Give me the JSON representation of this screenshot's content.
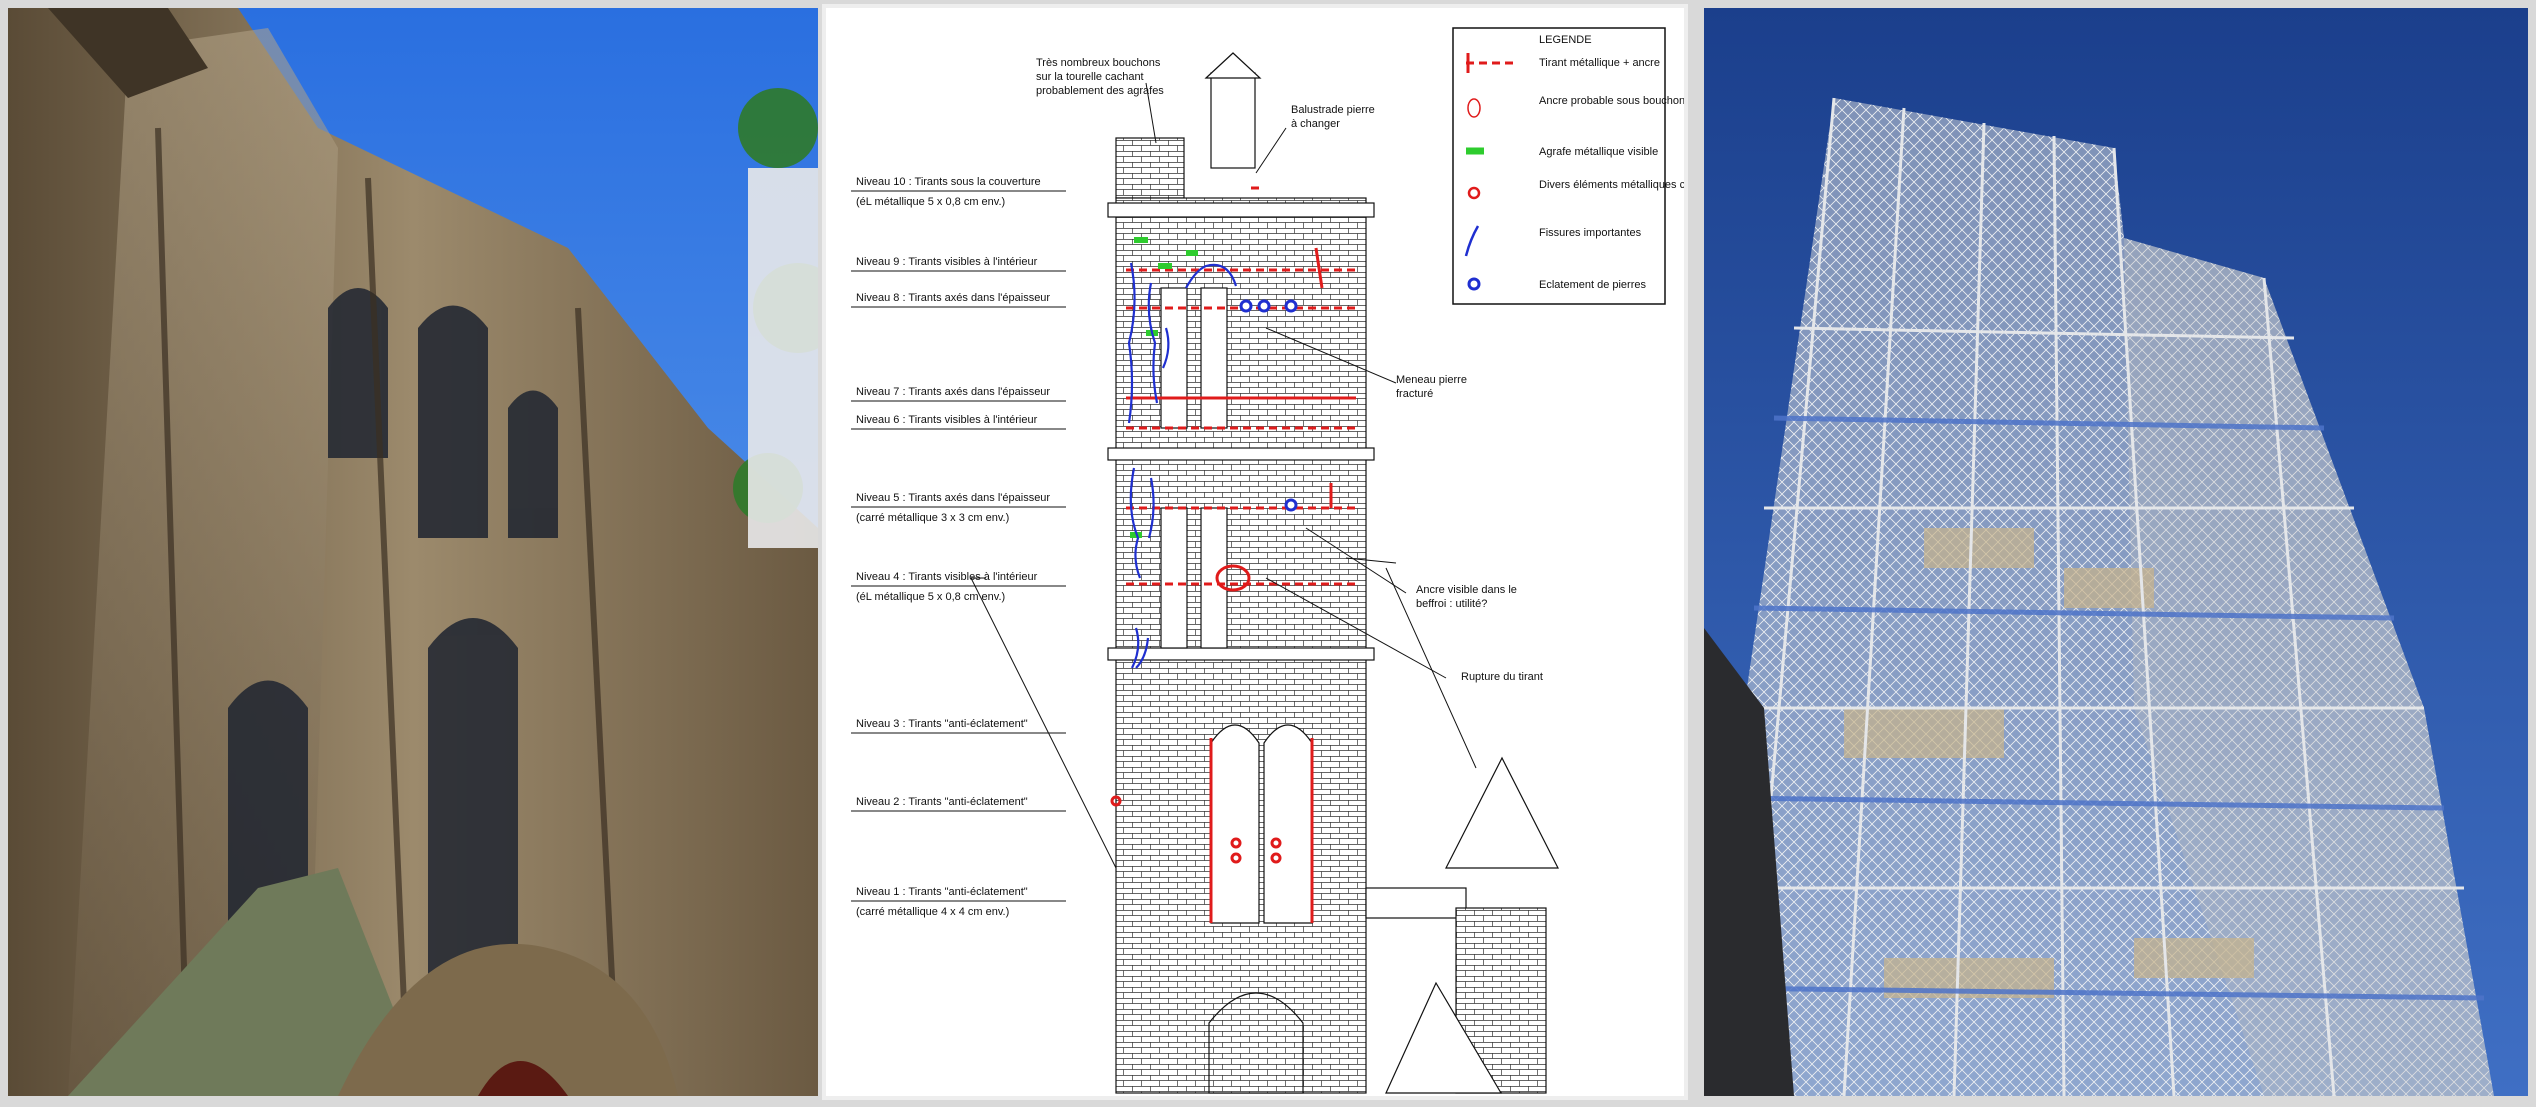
{
  "photos": {
    "left": {
      "name": "church-facade-photo"
    },
    "right": {
      "name": "tower-scaffolding-photo"
    }
  },
  "legend": {
    "title": "LEGENDE",
    "items": [
      {
        "label": "Tirant métallique + ancre",
        "symbol": "red-dashed-anchor-icon",
        "color": "#e01b1b"
      },
      {
        "label": "Ancre probable sous bouchon d'enduit",
        "symbol": "red-ellipse-icon",
        "color": "#e01b1b"
      },
      {
        "label": "Agrafe métallique visible",
        "symbol": "green-bar-icon",
        "color": "#2ecc2e"
      },
      {
        "label": "Divers éléments métalliques corrodés",
        "symbol": "red-circle-icon",
        "color": "#e01b1b"
      },
      {
        "label": "Fissures importantes",
        "symbol": "blue-crack-icon",
        "color": "#1f2fd0"
      },
      {
        "label": "Eclatement de pierres",
        "symbol": "blue-dot-icon",
        "color": "#1f2fd0"
      }
    ]
  },
  "levels": [
    {
      "title": "Niveau 10 : Tirants sous la couverture",
      "detail": "(éL métallique 5 x 0,8 cm env.)"
    },
    {
      "title": "Niveau 9 : Tirants visibles à l'intérieur",
      "detail": ""
    },
    {
      "title": "Niveau 8 : Tirants axés dans l'épaisseur",
      "detail": ""
    },
    {
      "title": "Niveau 7 : Tirants axés dans l'épaisseur",
      "detail": ""
    },
    {
      "title": "Niveau 6 : Tirants visibles à l'intérieur",
      "detail": ""
    },
    {
      "title": "Niveau 5 : Tirants axés dans l'épaisseur",
      "detail": "(carré métallique 3 x 3 cm env.)"
    },
    {
      "title": "Niveau 4 : Tirants visibles à l'intérieur",
      "detail": "(éL métallique 5 x 0,8 cm env.)"
    },
    {
      "title": "Niveau 3 : Tirants \"anti-éclatement\"",
      "detail": ""
    },
    {
      "title": "Niveau 2 : Tirants \"anti-éclatement\"",
      "detail": ""
    },
    {
      "title": "Niveau 1 : Tirants \"anti-éclatement\"",
      "detail": "(carré métallique 4 x 4 cm env.)"
    }
  ],
  "annotations": {
    "top_note": [
      "Très nombreux bouchons",
      "sur la tourelle cachant",
      "probablement des agrafes"
    ],
    "balustrade": [
      "Balustrade pierre",
      "à changer"
    ],
    "meneau": [
      "Meneau pierre",
      "fracturé"
    ],
    "ancre": [
      "Ancre visible dans le",
      "beffroi : utilité?"
    ],
    "rupture": [
      "Rupture du tirant"
    ]
  },
  "colors": {
    "tirant": "#e01b1b",
    "agrafe": "#2ecc2e",
    "fissure": "#1f2fd0",
    "stone": "#ffffff",
    "ink": "#111111"
  }
}
